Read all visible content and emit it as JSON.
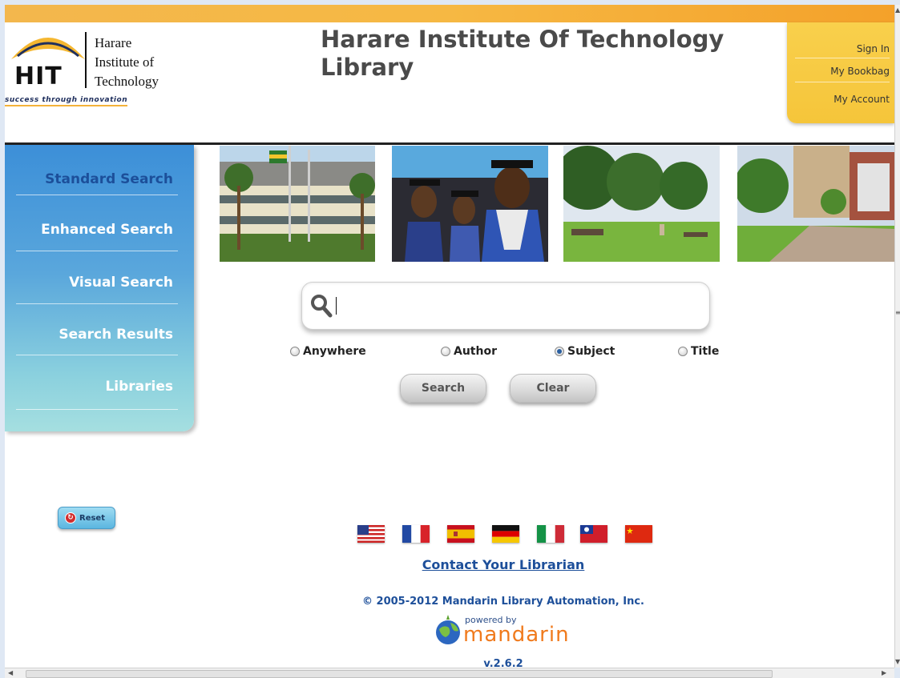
{
  "header": {
    "logo": {
      "abbr": "HIT",
      "name_lines": [
        "Harare",
        "Institute of",
        "Technology"
      ],
      "tagline": "success through innovation"
    },
    "title_line1": "Harare Institute Of Technology",
    "title_line2": "Library",
    "user_menu": [
      {
        "label": "Sign In"
      },
      {
        "label": "My Bookbag"
      },
      {
        "label": "My Account"
      }
    ]
  },
  "sidebar": {
    "items": [
      {
        "label": "Standard Search",
        "active": true
      },
      {
        "label": "Enhanced Search",
        "active": false
      },
      {
        "label": "Visual Search",
        "active": false
      },
      {
        "label": "Search Results",
        "active": false
      },
      {
        "label": "Libraries",
        "active": false
      }
    ]
  },
  "search": {
    "value": "",
    "icon": "magnifier-icon",
    "options": [
      {
        "label": "Anywhere",
        "selected": false
      },
      {
        "label": "Author",
        "selected": false
      },
      {
        "label": "Subject",
        "selected": true
      },
      {
        "label": "Title",
        "selected": false
      }
    ],
    "search_button": "Search",
    "clear_button": "Clear"
  },
  "reset_button": "Reset",
  "footer": {
    "flags": [
      "us-flag-icon",
      "france-flag-icon",
      "spain-flag-icon",
      "germany-flag-icon",
      "italy-flag-icon",
      "taiwan-flag-icon",
      "china-flag-icon"
    ],
    "contact_link": "Contact Your Librarian",
    "copyright": "© 2005-2012 Mandarin Library Automation, Inc.",
    "powered_by": "powered by",
    "brand": "mandarin",
    "version": "v.2.6.2"
  },
  "colors": {
    "accent_orange": "#f5a623",
    "user_menu_yellow": "#f7c83f",
    "nav_blue": "#3c8fd8",
    "nav_active_text": "#1c4f9a",
    "link_blue": "#1d4f9a",
    "brand_orange": "#f07a1c"
  }
}
